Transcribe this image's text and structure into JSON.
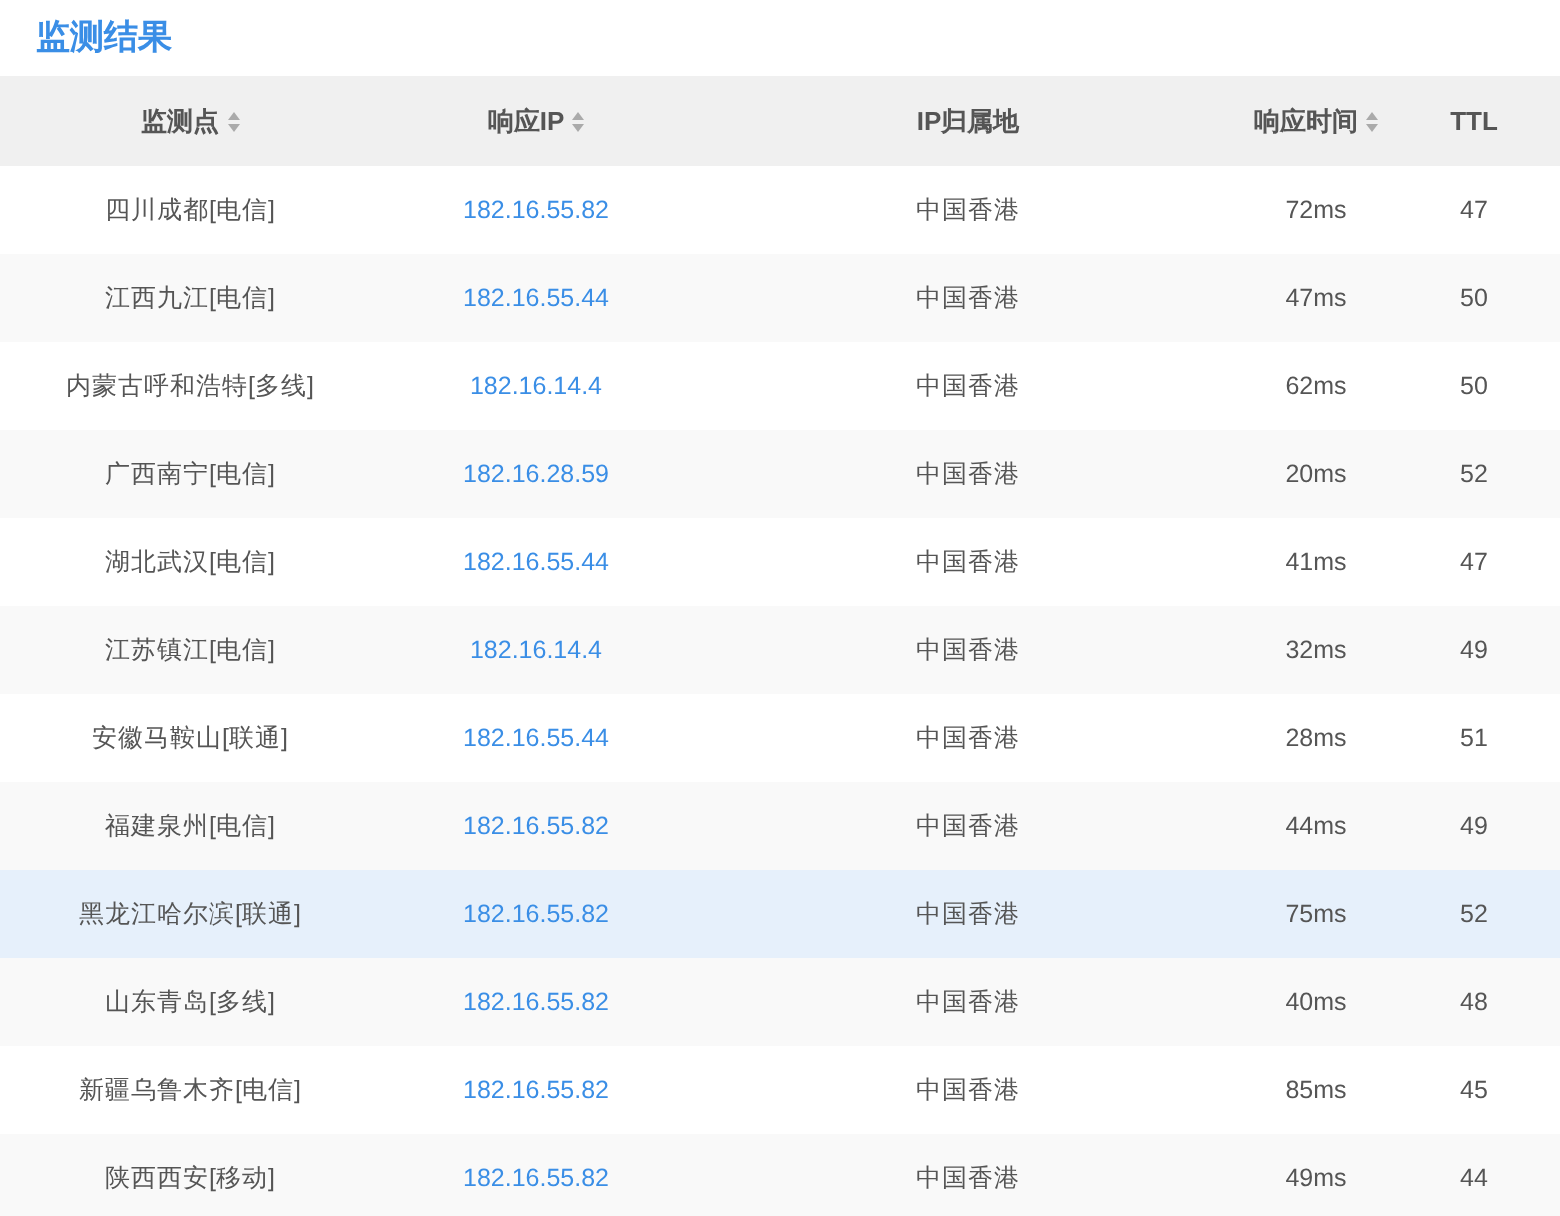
{
  "title": "监测结果",
  "table": {
    "columns": [
      {
        "label": "监测点",
        "sortable": true
      },
      {
        "label": "响应IP",
        "sortable": true
      },
      {
        "label": "IP归属地",
        "sortable": false
      },
      {
        "label": "响应时间",
        "sortable": true
      },
      {
        "label": "TTL",
        "sortable": false
      }
    ],
    "rows": [
      {
        "cells": [
          "四川成都[电信]",
          "182.16.55.82",
          "中国香港",
          "72ms",
          "47"
        ],
        "highlighted": false
      },
      {
        "cells": [
          "江西九江[电信]",
          "182.16.55.44",
          "中国香港",
          "47ms",
          "50"
        ],
        "highlighted": false
      },
      {
        "cells": [
          "内蒙古呼和浩特[多线]",
          "182.16.14.4",
          "中国香港",
          "62ms",
          "50"
        ],
        "highlighted": false
      },
      {
        "cells": [
          "广西南宁[电信]",
          "182.16.28.59",
          "中国香港",
          "20ms",
          "52"
        ],
        "highlighted": false
      },
      {
        "cells": [
          "湖北武汉[电信]",
          "182.16.55.44",
          "中国香港",
          "41ms",
          "47"
        ],
        "highlighted": false
      },
      {
        "cells": [
          "江苏镇江[电信]",
          "182.16.14.4",
          "中国香港",
          "32ms",
          "49"
        ],
        "highlighted": false
      },
      {
        "cells": [
          "安徽马鞍山[联通]",
          "182.16.55.44",
          "中国香港",
          "28ms",
          "51"
        ],
        "highlighted": false
      },
      {
        "cells": [
          "福建泉州[电信]",
          "182.16.55.82",
          "中国香港",
          "44ms",
          "49"
        ],
        "highlighted": false
      },
      {
        "cells": [
          "黑龙江哈尔滨[联通]",
          "182.16.55.82",
          "中国香港",
          "75ms",
          "52"
        ],
        "highlighted": true
      },
      {
        "cells": [
          "山东青岛[多线]",
          "182.16.55.82",
          "中国香港",
          "40ms",
          "48"
        ],
        "highlighted": false
      },
      {
        "cells": [
          "新疆乌鲁木齐[电信]",
          "182.16.55.82",
          "中国香港",
          "85ms",
          "45"
        ],
        "highlighted": false
      },
      {
        "cells": [
          "陕西西安[移动]",
          "182.16.55.82",
          "中国香港",
          "49ms",
          "44"
        ],
        "highlighted": false
      }
    ]
  }
}
